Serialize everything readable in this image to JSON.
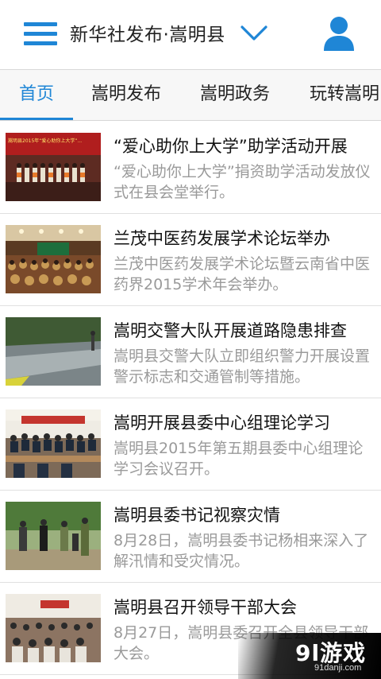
{
  "header": {
    "title": "新华社发布·嵩明县",
    "menu_icon": "menu-icon",
    "dropdown_icon": "chevron-down-icon",
    "user_icon": "user-icon",
    "accent_color": "#1f86d6"
  },
  "tabs": [
    {
      "label": "首页",
      "active": true
    },
    {
      "label": "嵩明发布",
      "active": false
    },
    {
      "label": "嵩明政务",
      "active": false
    },
    {
      "label": "玩转嵩明",
      "active": false
    }
  ],
  "news": [
    {
      "title": "“爱心助你上大学”助学活动开展",
      "desc": "“爱心助你上大学”捐资助学活动发放仪式在县会堂举行。",
      "image_banner": "嵩明县2015年“爱心助你上大学”..."
    },
    {
      "title": "兰茂中医药发展学术论坛举办",
      "desc": "兰茂中医药发展学术论坛暨云南省中医药界2015学术年会举办。"
    },
    {
      "title": "嵩明交警大队开展道路隐患排查",
      "desc": "嵩明县交警大队立即组织警力开展设置警示标志和交通管制等措施。"
    },
    {
      "title": "嵩明开展县委中心组理论学习",
      "desc": "嵩明县2015年第五期县委中心组理论学习会议召开。"
    },
    {
      "title": "嵩明县委书记视察灾情",
      "desc": "8月28日，嵩明县委书记杨相来深入了解汛情和受灾情况。"
    },
    {
      "title": "嵩明县召开领导干部大会",
      "desc": "8月27日，嵩明县委召开全县领导干部大会。"
    }
  ],
  "watermark": {
    "logo": "9l游戏",
    "url": "91danji.com"
  }
}
